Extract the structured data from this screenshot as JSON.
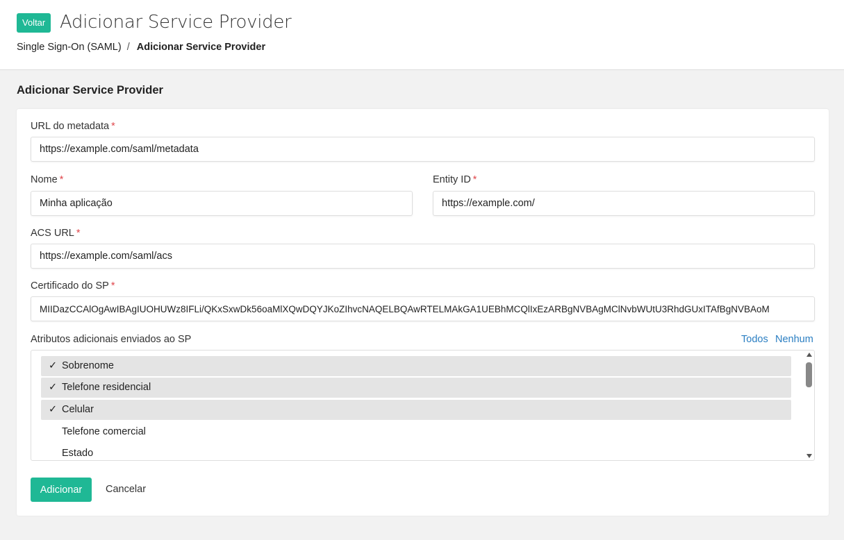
{
  "header": {
    "back_label": "Voltar",
    "title": "Adicionar Service Provider",
    "breadcrumb": {
      "parent": "Single Sign-On (SAML)",
      "separator": "/",
      "current": "Adicionar Service Provider"
    }
  },
  "section_title": "Adicionar Service Provider",
  "form": {
    "required_mark": "*",
    "metadata_url": {
      "label": "URL do metadata",
      "value": "https://example.com/saml/metadata"
    },
    "name": {
      "label": "Nome",
      "value": "Minha aplicação"
    },
    "entity_id": {
      "label": "Entity ID",
      "value": "https://example.com/"
    },
    "acs_url": {
      "label": "ACS URL",
      "value": "https://example.com/saml/acs"
    },
    "certificate": {
      "label": "Certificado do SP",
      "value": "MIIDazCCAlOgAwIBAgIUOHUWz8IFLi/QKxSxwDk56oaMlXQwDQYJKoZIhvcNAQELBQAwRTELMAkGA1UEBhMCQlIxEzARBgNVBAgMClNvbWUtU3RhdGUxITAfBgNVBAoM"
    },
    "attributes": {
      "label": "Atributos adicionais enviados ao SP",
      "select_all": "Todos",
      "select_none": "Nenhum",
      "check_mark": "✓",
      "options": [
        {
          "label": "Sobrenome",
          "selected": true
        },
        {
          "label": "Telefone residencial",
          "selected": true
        },
        {
          "label": "Celular",
          "selected": true
        },
        {
          "label": "Telefone comercial",
          "selected": false
        },
        {
          "label": "Estado",
          "selected": false
        }
      ]
    },
    "submit_label": "Adicionar",
    "cancel_label": "Cancelar"
  },
  "colors": {
    "accent": "#1fb895",
    "link": "#2a7ec2",
    "required": "#e0474c"
  }
}
